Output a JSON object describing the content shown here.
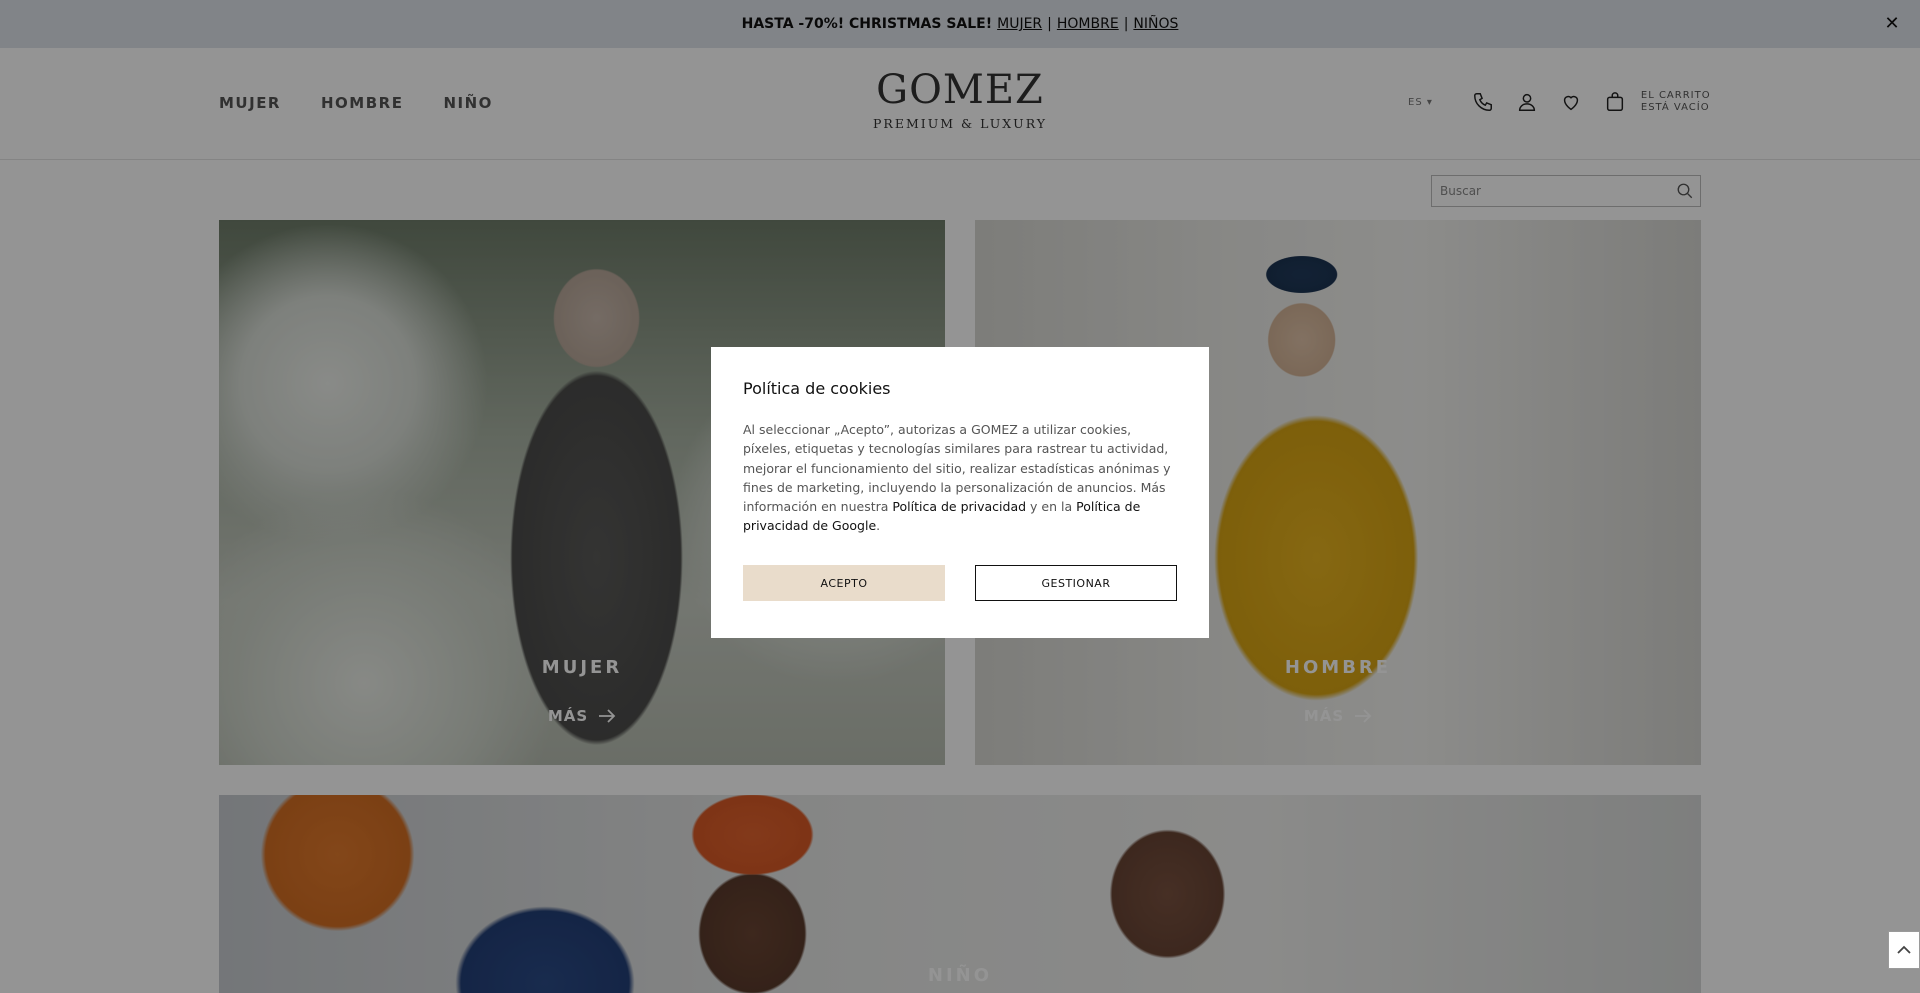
{
  "promo": {
    "headline": "HASTA -70%! CHRISTMAS SALE!",
    "links": [
      "MUJER",
      "HOMBRE",
      "NIÑOS"
    ],
    "separator": "|",
    "close": "✕"
  },
  "nav": {
    "items": [
      "MUJER",
      "HOMBRE",
      "NIÑO"
    ]
  },
  "logo": {
    "name": "GOMEZ",
    "tagline": "PREMIUM & LUXURY"
  },
  "header": {
    "language": "ES ▾",
    "cart_line1": "EL CARRITO",
    "cart_line2": "ESTÁ VACÍO",
    "icons": [
      "phone-icon",
      "user-icon",
      "heart-icon",
      "bag-icon"
    ]
  },
  "search": {
    "placeholder": "Buscar",
    "value": ""
  },
  "tiles": [
    {
      "title": "MUJER",
      "more": "MÁS"
    },
    {
      "title": "HOMBRE",
      "more": "MÁS"
    },
    {
      "title": "NIÑO"
    }
  ],
  "cookie": {
    "title": "Política de cookies",
    "text_part1": "Al seleccionar „Acepto”, autorizas a GOMEZ a utilizar cookies, píxeles, etiquetas y tecnologías similares para rastrear tu actividad, mejorar el funcionamiento del sitio, realizar estadísticas anónimas y fines de marketing, incluyendo la personalización de anuncios. Más información en nuestra ",
    "link_privacy": "Política de privacidad",
    "text_part2": " y en la ",
    "link_google": "Política de privacidad de Google",
    "text_end": ".",
    "accept_label": "ACEPTO",
    "manage_label": "GESTIONAR"
  },
  "colors": {
    "promo_bg": "#dfe3ea",
    "accept_bg": "#e9dccb",
    "overlay": "rgba(0,0,0,0.42)"
  }
}
